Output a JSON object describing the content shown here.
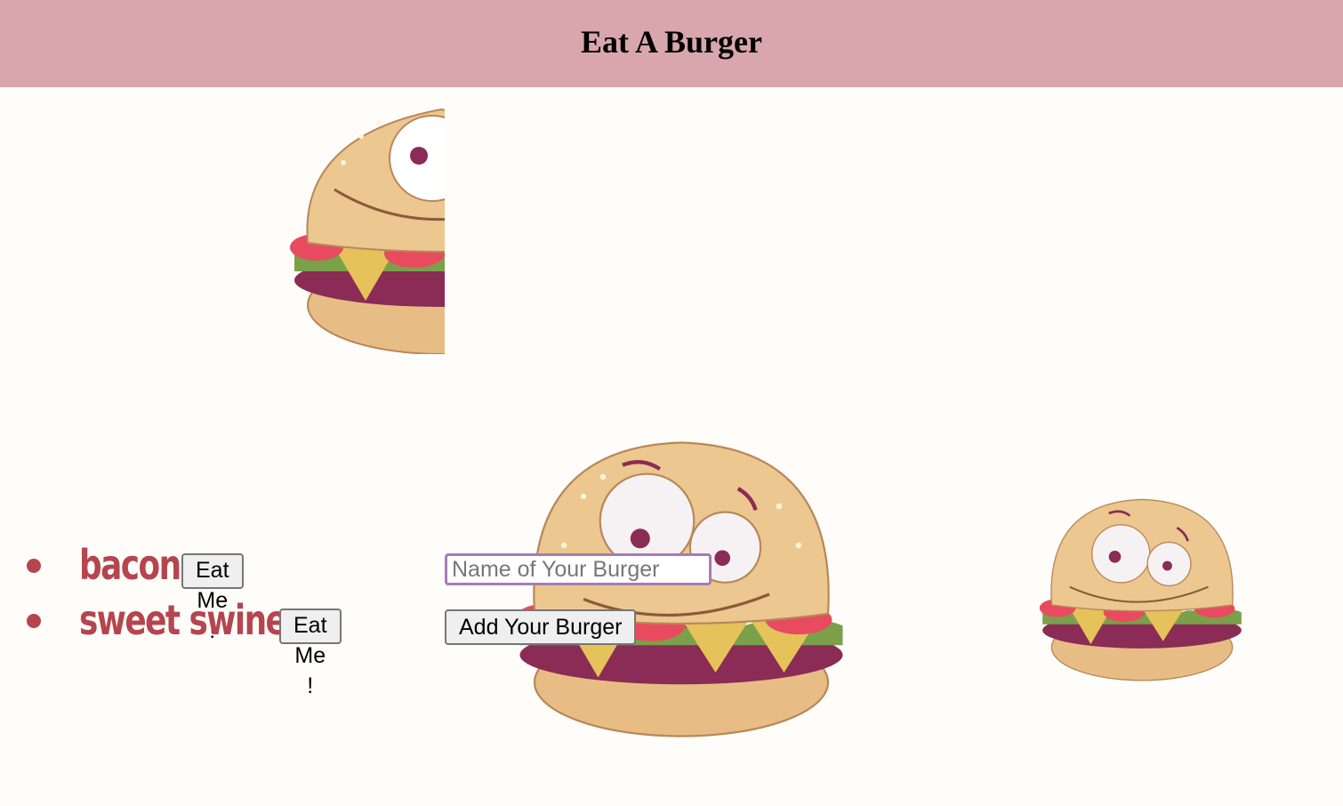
{
  "header": {
    "title": "Eat A Burger"
  },
  "colors": {
    "header_bg": "#d9a6ae",
    "page_bg": "#fefdf9",
    "burger_name": "#b5454e",
    "input_border": "#a77bb5"
  },
  "burgers": [
    {
      "name": "bacon",
      "eat_label": "Eat Me !"
    },
    {
      "name": "sweet swine",
      "eat_label": "Eat Me !"
    }
  ],
  "form": {
    "input_placeholder": "Name of Your Burger",
    "input_value": "",
    "submit_label": "Add Your Burger"
  },
  "images": [
    {
      "icon": "cartoon-burger-icon",
      "description_name": "burger-mascot"
    }
  ]
}
